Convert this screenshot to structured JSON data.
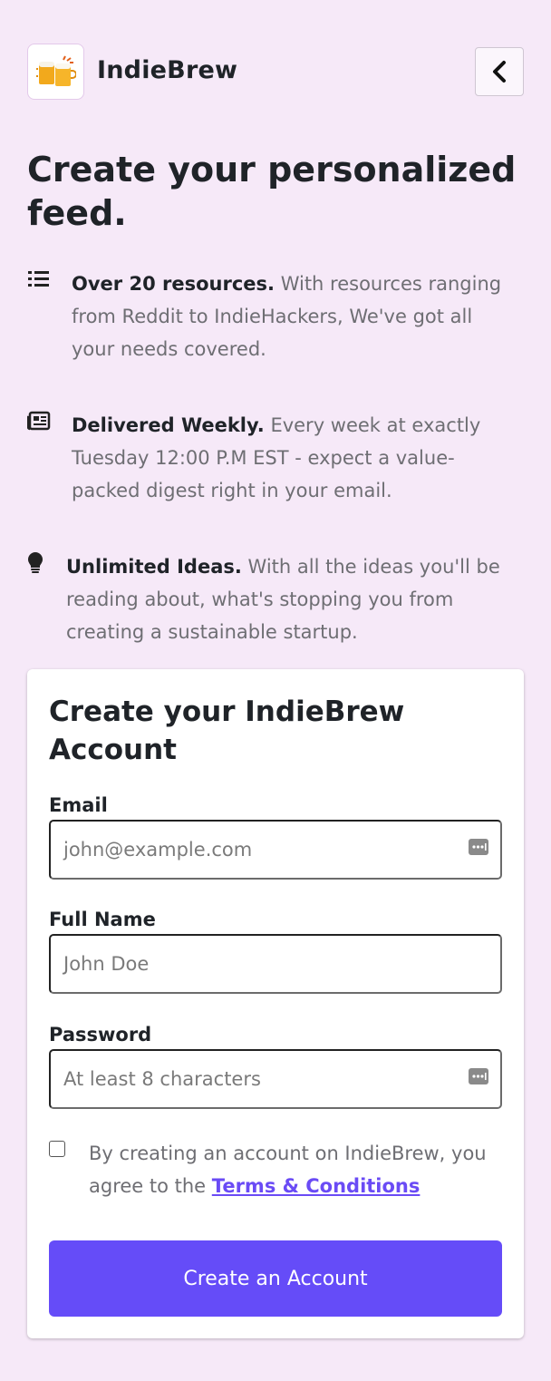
{
  "header": {
    "brand": "IndieBrew",
    "logo_icon": "beer-mugs-icon",
    "back_icon": "chevron-left-icon"
  },
  "headline": "Create your personalized feed.",
  "features": [
    {
      "icon": "list-icon",
      "title": "Over 20 resources.",
      "text": "With resources ranging from Reddit to IndieHackers, We've got all your needs covered."
    },
    {
      "icon": "newspaper-icon",
      "title": "Delivered Weekly.",
      "text": "Every week at exactly Tuesday 12:00 P.M EST - expect a value-packed digest right in your email."
    },
    {
      "icon": "lightbulb-icon",
      "title": "Unlimited Ideas.",
      "text": "With all the ideas you'll be reading about, what's stopping you from creating a sustainable startup."
    }
  ],
  "form": {
    "title": "Create your IndieBrew Account",
    "email": {
      "label": "Email",
      "placeholder": "john@example.com",
      "value": ""
    },
    "name": {
      "label": "Full Name",
      "placeholder": "John Doe",
      "value": ""
    },
    "password": {
      "label": "Password",
      "placeholder": "At least 8 characters",
      "value": ""
    },
    "agreement": {
      "text": "By creating an account on IndieBrew, you agree to the",
      "link": "Terms & Conditions",
      "checked": false
    },
    "submit_label": "Create an Account"
  },
  "colors": {
    "background": "#f6e9f8",
    "accent": "#654cf8",
    "link": "#6a4bf5"
  }
}
